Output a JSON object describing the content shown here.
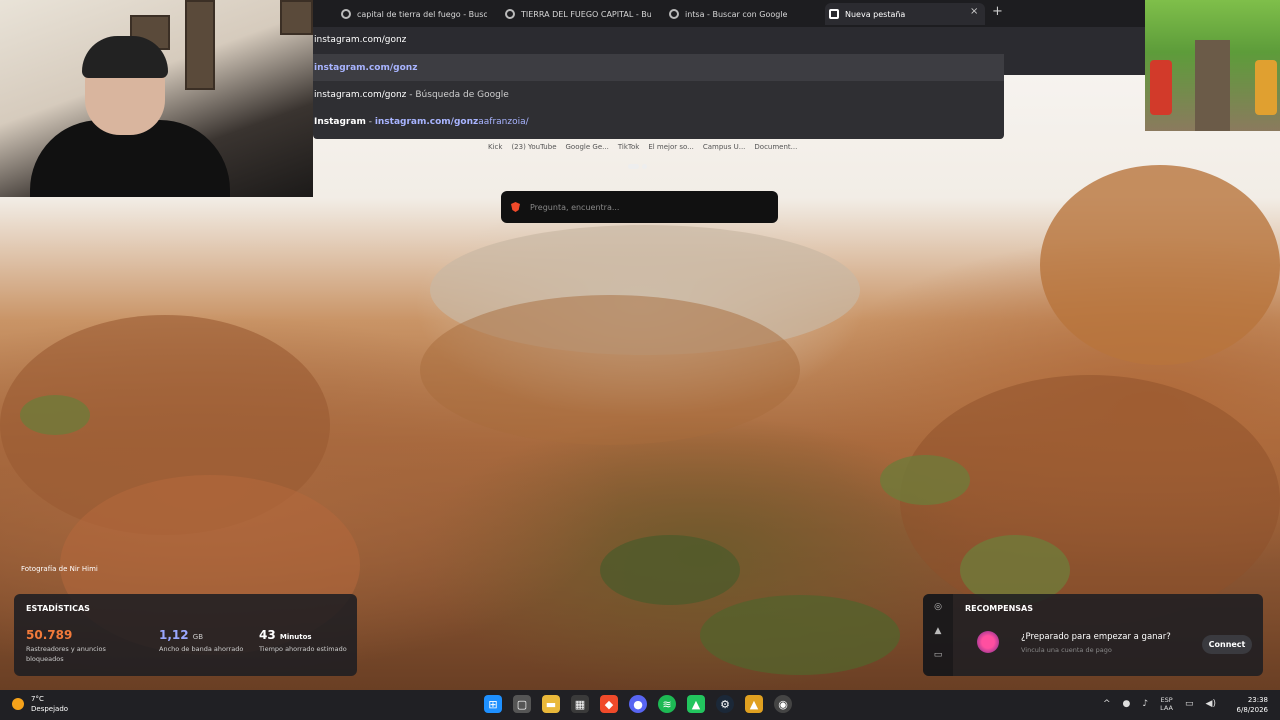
{
  "browser": {
    "tabs": [
      {
        "label": "capital de tierra del fuego - Buscar co"
      },
      {
        "label": "TIERRA DEL FUEGO CAPITAL - Buscar"
      },
      {
        "label": "intsa - Buscar con Google"
      },
      {
        "label": "Nueva pestaña"
      }
    ],
    "close_glyph": "×",
    "new_tab_glyph": "+",
    "omnibox_value": "instagram.com/gonz",
    "suggestions": [
      {
        "text": "instagram.com/gonz"
      },
      {
        "text": "instagram.com/gonz",
        "suffix": " - Búsqueda de Google"
      },
      {
        "site": "Instagram",
        "sep": " - ",
        "url_bold": "instagram.com/gonz",
        "url_rest": "aafranzoia/"
      }
    ],
    "bookmarks": [
      "Kick",
      "(23) YouTube",
      "Google Ge...",
      "TikTok",
      "El mejor so...",
      "Campus U...",
      "Document..."
    ],
    "search_placeholder": "Pregunta, encuentra..."
  },
  "photo_credit": "Fotografía de Nir Himi",
  "stats": {
    "title": "ESTADÍSTICAS",
    "items": [
      {
        "value": "50.789",
        "unit": "",
        "desc": "Rastreadores y anuncios bloqueados",
        "color": "#f27a3a"
      },
      {
        "value": "1,12",
        "unit": "GB",
        "desc": "Ancho de banda ahorrado",
        "color": "#9aa7ff"
      },
      {
        "value": "43",
        "unit": "Minutos",
        "desc": "Tiempo ahorrado estimado",
        "color": "#ffffff"
      }
    ]
  },
  "rewards": {
    "title": "RECOMPENSAS",
    "question": "¿Preparado para empezar a ganar?",
    "sub": "Vincula una cuenta de pago",
    "connect_label": "Connect"
  },
  "taskbar": {
    "weather_temp": "7°C",
    "weather_desc": "Despejado",
    "apps": [
      "windows-icon",
      "task-view-icon",
      "file-explorer-icon",
      "store-icon",
      "brave-icon",
      "discord-icon",
      "spotify-icon",
      "game-icon",
      "steam-icon",
      "app-icon",
      "chrome-icon"
    ],
    "lang_top": "ESP",
    "lang_bottom": "LAA",
    "time": "23:38",
    "date": "6/8/2026"
  }
}
